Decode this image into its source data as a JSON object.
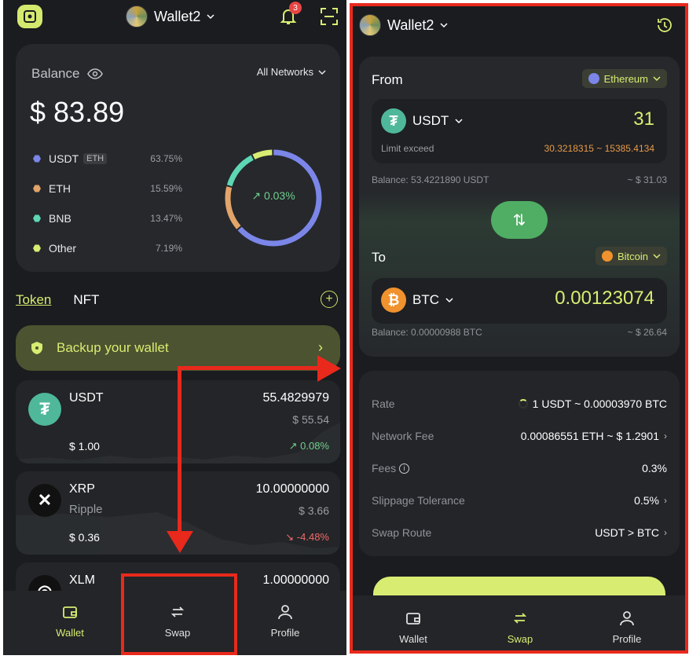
{
  "left": {
    "wallet_name": "Wallet2",
    "notification_count": "3",
    "balance": {
      "label": "Balance",
      "network_filter": "All Networks",
      "amount": "$ 83.89",
      "change": "0.03%",
      "allocation": [
        {
          "symbol": "USDT",
          "tag": "ETH",
          "percent": "63.75%",
          "color": "#7b86e8"
        },
        {
          "symbol": "ETH",
          "tag": "",
          "percent": "15.59%",
          "color": "#e3a46a"
        },
        {
          "symbol": "BNB",
          "tag": "",
          "percent": "13.47%",
          "color": "#5ed8b4"
        },
        {
          "symbol": "Other",
          "tag": "",
          "percent": "7.19%",
          "color": "#d8ec72"
        }
      ]
    },
    "tabs": {
      "token": "Token",
      "nft": "NFT"
    },
    "backup": {
      "label": "Backup your wallet"
    },
    "tokens": [
      {
        "symbol": "USDT",
        "name": "",
        "amount": "55.4829979",
        "usd": "$ 55.54",
        "price": "$ 1.00",
        "change": "0.08%",
        "direction": "up"
      },
      {
        "symbol": "XRP",
        "name": "Ripple",
        "amount": "10.00000000",
        "usd": "$ 3.66",
        "price": "$ 0.36",
        "change": "-4.48%",
        "direction": "down"
      },
      {
        "symbol": "XLM",
        "name": "",
        "amount": "1.00000000",
        "usd": "",
        "price": "",
        "change": "",
        "direction": ""
      }
    ],
    "nav": {
      "wallet": "Wallet",
      "swap": "Swap",
      "profile": "Profile"
    }
  },
  "right": {
    "wallet_name": "Wallet2",
    "from": {
      "label": "From",
      "chain": "Ethereum",
      "symbol": "USDT",
      "amount": "31",
      "limit_label": "Limit exceed",
      "limit_range": "30.3218315 ~ 15385.4134",
      "balance": "Balance: 53.4221890 USDT",
      "balance_usd": "~ $ 31.03"
    },
    "to": {
      "label": "To",
      "chain": "Bitcoin",
      "symbol": "BTC",
      "amount": "0.00123074",
      "balance": "Balance: 0.00000988 BTC",
      "balance_usd": "~ $ 26.64"
    },
    "details": {
      "rate_label": "Rate",
      "rate_value": "1 USDT ~ 0.00003970 BTC",
      "network_fee_label": "Network Fee",
      "network_fee_value": "0.00086551 ETH ~ $ 1.2901",
      "fees_label": "Fees",
      "fees_value": "0.3%",
      "slippage_label": "Slippage Tolerance",
      "slippage_value": "0.5%",
      "route_label": "Swap Route",
      "route_value": "USDT > BTC"
    },
    "nav": {
      "wallet": "Wallet",
      "swap": "Swap",
      "profile": "Profile"
    }
  },
  "colors": {
    "accent": "#d8ec72",
    "up": "#6fd08c",
    "down": "#f06a6a",
    "annotation": "#e8291c"
  }
}
